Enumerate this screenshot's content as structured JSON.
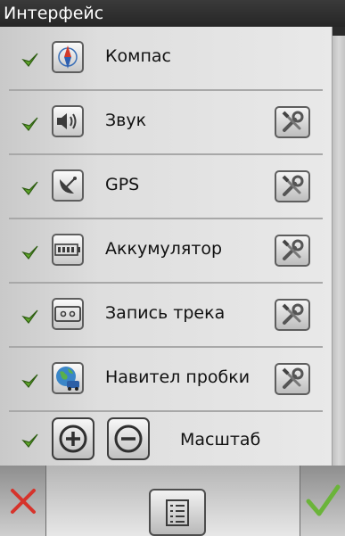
{
  "window": {
    "title": "Интерфейс"
  },
  "items": [
    {
      "label": "Компас",
      "icon": "compass-icon",
      "checked": true,
      "has_settings": false
    },
    {
      "label": "Звук",
      "icon": "speaker-icon",
      "checked": true,
      "has_settings": true
    },
    {
      "label": "GPS",
      "icon": "satellite-dish-icon",
      "checked": true,
      "has_settings": true
    },
    {
      "label": "Аккумулятор",
      "icon": "battery-icon",
      "checked": true,
      "has_settings": true
    },
    {
      "label": "Запись трека",
      "icon": "cassette-icon",
      "checked": true,
      "has_settings": true
    },
    {
      "label": "Навител пробки",
      "icon": "traffic-globe-icon",
      "checked": true,
      "has_settings": true
    },
    {
      "label": "Масштаб",
      "icon": "zoom-in-out-icons",
      "checked": true,
      "has_settings": false
    }
  ],
  "bottom": {
    "cancel_icon": "close-icon",
    "menu_icon": "list-icon",
    "ok_icon": "checkmark-icon"
  },
  "colors": {
    "check_green": "#5fa52a",
    "cancel_red": "#d6332b",
    "ok_green": "#6bb43a",
    "titlebar_bg": "#2f2f2f"
  }
}
